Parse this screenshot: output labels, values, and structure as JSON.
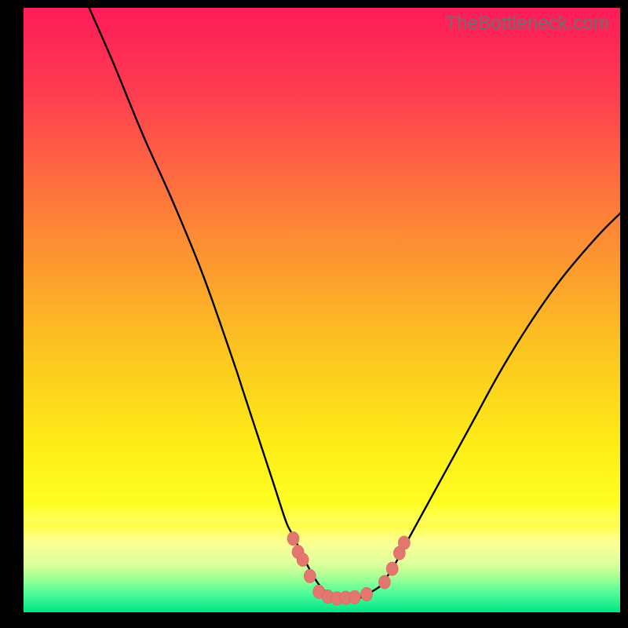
{
  "watermark": {
    "text": "TheBottleneck.com"
  },
  "colors": {
    "frame_bg": "#000000",
    "curve": "#000000",
    "curve_width": 2.4,
    "marker_fill": "#e2776f",
    "marker_stroke": "#d9665e",
    "gradient_stops": [
      {
        "pct": 0,
        "color": "#fe1b59"
      },
      {
        "pct": 15,
        "color": "#fe3f4f"
      },
      {
        "pct": 35,
        "color": "#fd8237"
      },
      {
        "pct": 55,
        "color": "#fcc022"
      },
      {
        "pct": 72,
        "color": "#fdec17"
      },
      {
        "pct": 82,
        "color": "#fefe23"
      },
      {
        "pct": 88,
        "color": "#feff98"
      },
      {
        "pct": 93,
        "color": "#c8ff82"
      },
      {
        "pct": 97,
        "color": "#40ffa1"
      },
      {
        "pct": 100,
        "color": "#00e586"
      }
    ],
    "band_stops": [
      {
        "pct": 0,
        "color": "#fefe23"
      },
      {
        "pct": 25,
        "color": "#feff98"
      },
      {
        "pct": 45,
        "color": "#e6ffae"
      },
      {
        "pct": 70,
        "color": "#7fff96"
      },
      {
        "pct": 100,
        "color": "#00e586"
      }
    ]
  },
  "chart_data": {
    "type": "line",
    "title": "",
    "xlabel": "",
    "ylabel": "",
    "xlim": [
      0,
      100
    ],
    "ylim": [
      0,
      100
    ],
    "series": [
      {
        "name": "bottleneck-curve",
        "x": [
          11,
          15,
          20,
          25,
          30,
          35,
          37,
          40,
          42,
          44,
          45,
          46,
          48,
          50,
          52,
          54,
          56,
          57,
          58,
          60,
          61,
          62,
          65,
          70,
          75,
          80,
          85,
          90,
          96,
          100
        ],
        "y": [
          100,
          91,
          79,
          68,
          56,
          42,
          36,
          27,
          21,
          15,
          13,
          11,
          7,
          4,
          2.7,
          2.2,
          2.3,
          2.7,
          3.2,
          4.5,
          6,
          7.5,
          13,
          22,
          31,
          40,
          48,
          55,
          62,
          66
        ]
      }
    ],
    "markers": {
      "name": "bottom-cluster",
      "points": [
        {
          "x": 45.2,
          "y": 12.2
        },
        {
          "x": 46.0,
          "y": 10.0
        },
        {
          "x": 46.8,
          "y": 8.7
        },
        {
          "x": 48.0,
          "y": 6.0
        },
        {
          "x": 49.5,
          "y": 3.4
        },
        {
          "x": 51.0,
          "y": 2.6
        },
        {
          "x": 52.5,
          "y": 2.3
        },
        {
          "x": 54.0,
          "y": 2.4
        },
        {
          "x": 55.5,
          "y": 2.5
        },
        {
          "x": 57.5,
          "y": 3.0
        },
        {
          "x": 60.5,
          "y": 5.0
        },
        {
          "x": 61.8,
          "y": 7.2
        },
        {
          "x": 63.0,
          "y": 9.8
        },
        {
          "x": 63.8,
          "y": 11.5
        }
      ],
      "radius": 7.5
    }
  },
  "bottom_band_height_pct": 15
}
